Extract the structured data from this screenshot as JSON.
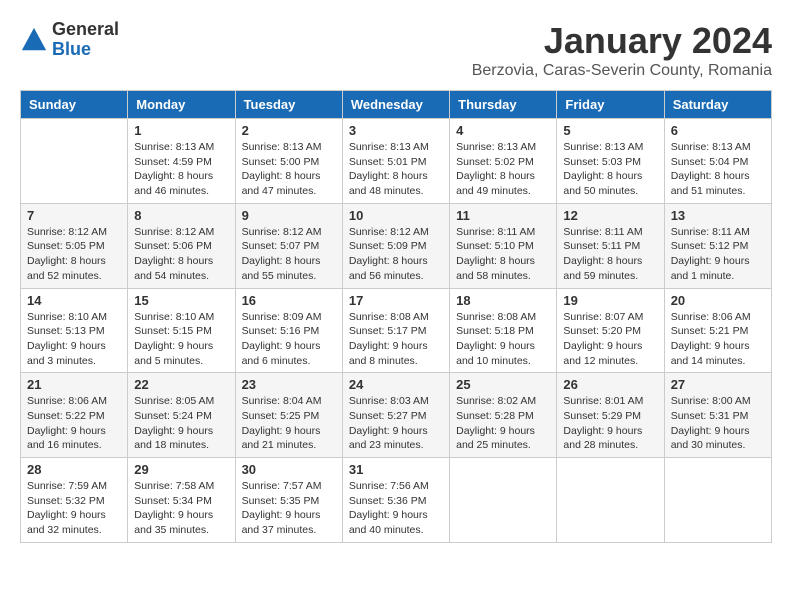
{
  "logo": {
    "general": "General",
    "blue": "Blue"
  },
  "title": "January 2024",
  "subtitle": "Berzovia, Caras-Severin County, Romania",
  "days_header": [
    "Sunday",
    "Monday",
    "Tuesday",
    "Wednesday",
    "Thursday",
    "Friday",
    "Saturday"
  ],
  "weeks": [
    [
      {
        "day": "",
        "info": ""
      },
      {
        "day": "1",
        "info": "Sunrise: 8:13 AM\nSunset: 4:59 PM\nDaylight: 8 hours\nand 46 minutes."
      },
      {
        "day": "2",
        "info": "Sunrise: 8:13 AM\nSunset: 5:00 PM\nDaylight: 8 hours\nand 47 minutes."
      },
      {
        "day": "3",
        "info": "Sunrise: 8:13 AM\nSunset: 5:01 PM\nDaylight: 8 hours\nand 48 minutes."
      },
      {
        "day": "4",
        "info": "Sunrise: 8:13 AM\nSunset: 5:02 PM\nDaylight: 8 hours\nand 49 minutes."
      },
      {
        "day": "5",
        "info": "Sunrise: 8:13 AM\nSunset: 5:03 PM\nDaylight: 8 hours\nand 50 minutes."
      },
      {
        "day": "6",
        "info": "Sunrise: 8:13 AM\nSunset: 5:04 PM\nDaylight: 8 hours\nand 51 minutes."
      }
    ],
    [
      {
        "day": "7",
        "info": "Sunrise: 8:12 AM\nSunset: 5:05 PM\nDaylight: 8 hours\nand 52 minutes."
      },
      {
        "day": "8",
        "info": "Sunrise: 8:12 AM\nSunset: 5:06 PM\nDaylight: 8 hours\nand 54 minutes."
      },
      {
        "day": "9",
        "info": "Sunrise: 8:12 AM\nSunset: 5:07 PM\nDaylight: 8 hours\nand 55 minutes."
      },
      {
        "day": "10",
        "info": "Sunrise: 8:12 AM\nSunset: 5:09 PM\nDaylight: 8 hours\nand 56 minutes."
      },
      {
        "day": "11",
        "info": "Sunrise: 8:11 AM\nSunset: 5:10 PM\nDaylight: 8 hours\nand 58 minutes."
      },
      {
        "day": "12",
        "info": "Sunrise: 8:11 AM\nSunset: 5:11 PM\nDaylight: 8 hours\nand 59 minutes."
      },
      {
        "day": "13",
        "info": "Sunrise: 8:11 AM\nSunset: 5:12 PM\nDaylight: 9 hours\nand 1 minute."
      }
    ],
    [
      {
        "day": "14",
        "info": "Sunrise: 8:10 AM\nSunset: 5:13 PM\nDaylight: 9 hours\nand 3 minutes."
      },
      {
        "day": "15",
        "info": "Sunrise: 8:10 AM\nSunset: 5:15 PM\nDaylight: 9 hours\nand 5 minutes."
      },
      {
        "day": "16",
        "info": "Sunrise: 8:09 AM\nSunset: 5:16 PM\nDaylight: 9 hours\nand 6 minutes."
      },
      {
        "day": "17",
        "info": "Sunrise: 8:08 AM\nSunset: 5:17 PM\nDaylight: 9 hours\nand 8 minutes."
      },
      {
        "day": "18",
        "info": "Sunrise: 8:08 AM\nSunset: 5:18 PM\nDaylight: 9 hours\nand 10 minutes."
      },
      {
        "day": "19",
        "info": "Sunrise: 8:07 AM\nSunset: 5:20 PM\nDaylight: 9 hours\nand 12 minutes."
      },
      {
        "day": "20",
        "info": "Sunrise: 8:06 AM\nSunset: 5:21 PM\nDaylight: 9 hours\nand 14 minutes."
      }
    ],
    [
      {
        "day": "21",
        "info": "Sunrise: 8:06 AM\nSunset: 5:22 PM\nDaylight: 9 hours\nand 16 minutes."
      },
      {
        "day": "22",
        "info": "Sunrise: 8:05 AM\nSunset: 5:24 PM\nDaylight: 9 hours\nand 18 minutes."
      },
      {
        "day": "23",
        "info": "Sunrise: 8:04 AM\nSunset: 5:25 PM\nDaylight: 9 hours\nand 21 minutes."
      },
      {
        "day": "24",
        "info": "Sunrise: 8:03 AM\nSunset: 5:27 PM\nDaylight: 9 hours\nand 23 minutes."
      },
      {
        "day": "25",
        "info": "Sunrise: 8:02 AM\nSunset: 5:28 PM\nDaylight: 9 hours\nand 25 minutes."
      },
      {
        "day": "26",
        "info": "Sunrise: 8:01 AM\nSunset: 5:29 PM\nDaylight: 9 hours\nand 28 minutes."
      },
      {
        "day": "27",
        "info": "Sunrise: 8:00 AM\nSunset: 5:31 PM\nDaylight: 9 hours\nand 30 minutes."
      }
    ],
    [
      {
        "day": "28",
        "info": "Sunrise: 7:59 AM\nSunset: 5:32 PM\nDaylight: 9 hours\nand 32 minutes."
      },
      {
        "day": "29",
        "info": "Sunrise: 7:58 AM\nSunset: 5:34 PM\nDaylight: 9 hours\nand 35 minutes."
      },
      {
        "day": "30",
        "info": "Sunrise: 7:57 AM\nSunset: 5:35 PM\nDaylight: 9 hours\nand 37 minutes."
      },
      {
        "day": "31",
        "info": "Sunrise: 7:56 AM\nSunset: 5:36 PM\nDaylight: 9 hours\nand 40 minutes."
      },
      {
        "day": "",
        "info": ""
      },
      {
        "day": "",
        "info": ""
      },
      {
        "day": "",
        "info": ""
      }
    ]
  ]
}
